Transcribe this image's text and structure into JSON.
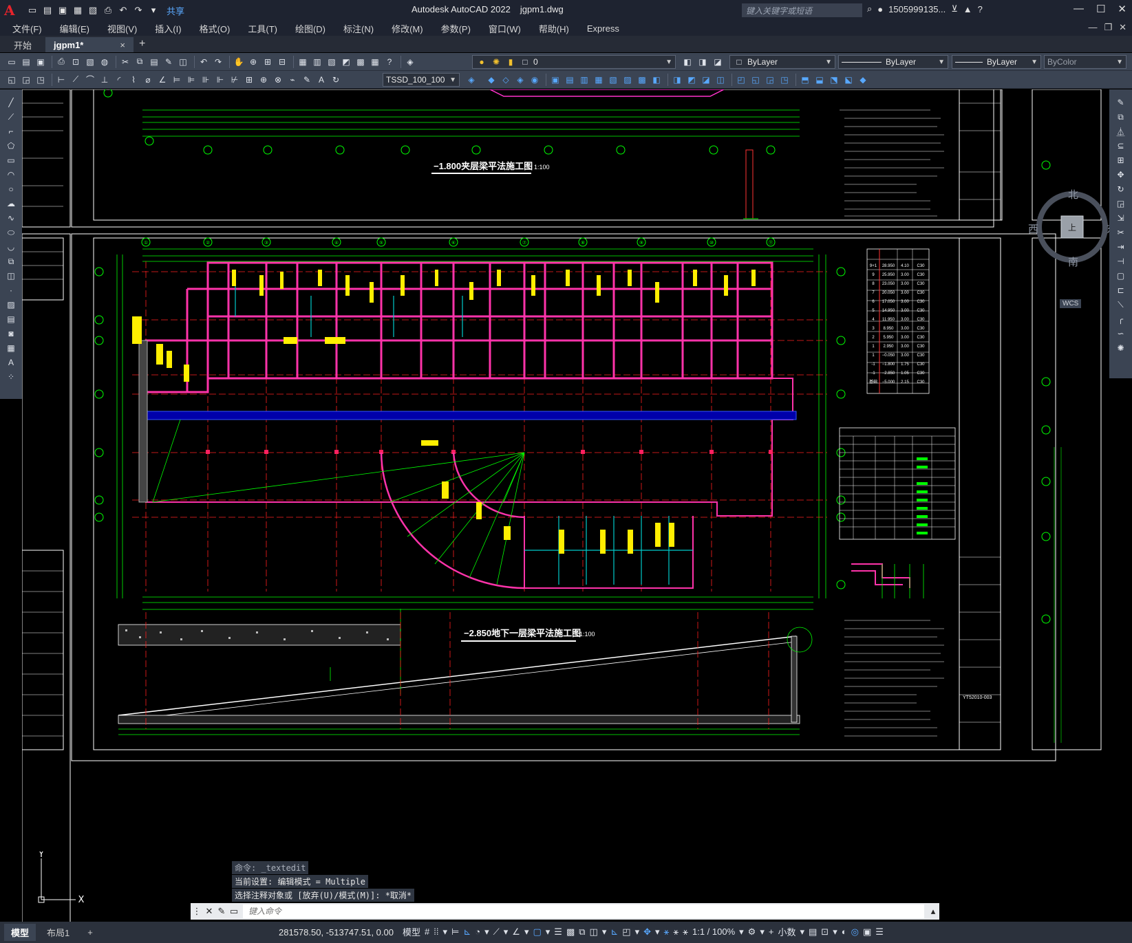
{
  "app": {
    "product": "Autodesk AutoCAD 2022",
    "filename": "jgpm1.dwg",
    "search_placeholder": "键入关键字或短语",
    "user": "1505999135...",
    "share": "共享"
  },
  "menu": [
    "文件(F)",
    "编辑(E)",
    "视图(V)",
    "插入(I)",
    "格式(O)",
    "工具(T)",
    "绘图(D)",
    "标注(N)",
    "修改(M)",
    "参数(P)",
    "窗口(W)",
    "帮助(H)",
    "Express"
  ],
  "tabs": {
    "start": "开始",
    "drawing": "jgpm1*",
    "close": "×",
    "add": "+"
  },
  "toolbar": {
    "layer_value": "0",
    "color": "ByLayer",
    "linetype": "ByLayer",
    "lineweight": "ByLayer",
    "plotstyle": "ByColor",
    "dimstyle": "TSSD_100_100"
  },
  "drawing": {
    "top_title": "−1.800夹层梁平法施工图",
    "top_scale": "1:100",
    "main_title": "−2.850地下一层梁平法施工图",
    "main_scale": "1:100",
    "sheet_no": "YT52010-003",
    "grid_bubbles": [
      "①",
      "②",
      "③",
      "④",
      "⑤",
      "⑥",
      "⑦",
      "⑧",
      "⑨",
      "⑩",
      "⑪",
      "⑫",
      "⑬",
      "⑭",
      "⑮",
      "⑯",
      "⑰",
      "⑱",
      "⑲",
      "⑳",
      "㉑",
      "㉒",
      "㉓",
      "㉔"
    ],
    "level_table": [
      [
        "9+1",
        "28.950",
        "4.10",
        "C30"
      ],
      [
        "9",
        "25.950",
        "3.00",
        "C30"
      ],
      [
        "8",
        "23.050",
        "3.00",
        "C30"
      ],
      [
        "7",
        "20.050",
        "3.00",
        "C30"
      ],
      [
        "6",
        "17.050",
        "3.00",
        "C30"
      ],
      [
        "5",
        "14.950",
        "3.00",
        "C30"
      ],
      [
        "4",
        "11.950",
        "3.00",
        "C30"
      ],
      [
        "3",
        "8.950",
        "3.00",
        "C30"
      ],
      [
        "2",
        "5.950",
        "3.00",
        "C30"
      ],
      [
        "1",
        "2.950",
        "3.00",
        "C30"
      ],
      [
        "1",
        "−0.050",
        "3.00",
        "C30"
      ],
      [
        "-1",
        "−1.800",
        "1.75",
        "C30"
      ],
      [
        "-1",
        "−2.850",
        "1.05",
        "C30"
      ],
      [
        "基础",
        "−5.000",
        "2.15",
        "C30"
      ]
    ]
  },
  "viewcube": {
    "north": "北",
    "south": "南",
    "east": "东",
    "west": "西",
    "top": "上",
    "wcs": "WCS"
  },
  "command": {
    "history": [
      "命令: _textedit",
      "当前设置: 编辑模式 = Multiple",
      "选择注释对象或 [放弃(U)/模式(M)]: *取消*"
    ],
    "placeholder": "键入命令"
  },
  "ucs": {
    "x": "X",
    "y": "Y"
  },
  "status": {
    "layout_tabs": [
      "模型",
      "布局1"
    ],
    "add": "+",
    "coords": "281578.50, -513747.51, 0.00",
    "model": "模型",
    "scale": "1:1 / 100%",
    "units": "小数"
  }
}
